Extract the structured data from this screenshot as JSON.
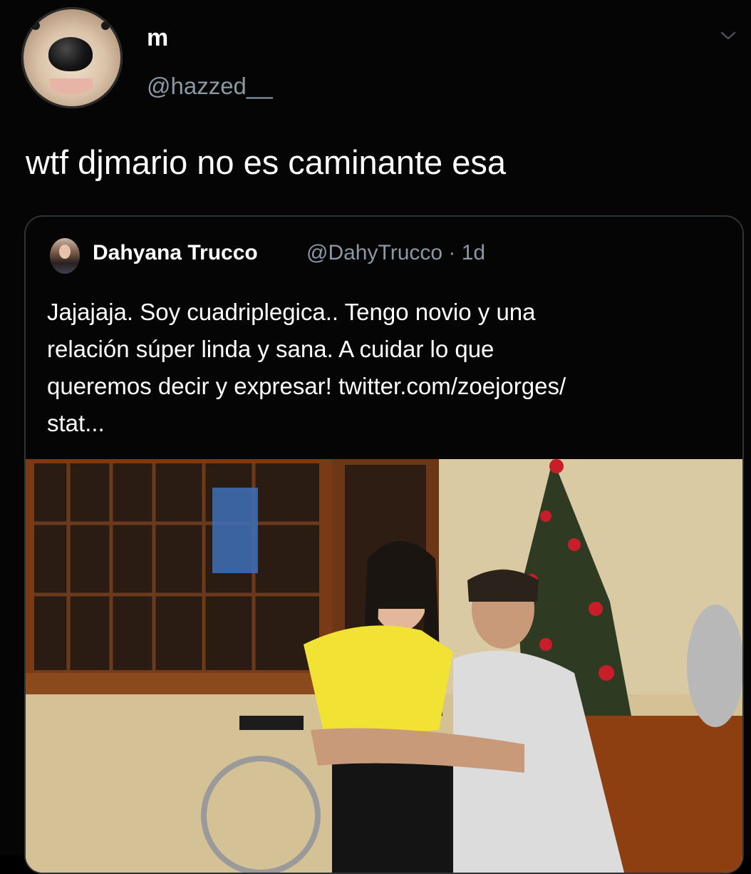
{
  "tweet": {
    "author": {
      "display_name": "m",
      "handle": "@hazzed__"
    },
    "text": "wtf djmario no es caminante esa",
    "menu_icon": "chevron-down-icon"
  },
  "quoted_tweet": {
    "author": {
      "display_name": "Dahyana Trucco",
      "handle": "@DahyTrucco",
      "separator": "·",
      "time": "1d"
    },
    "lines": [
      "Jajajaja. Soy cuadriplegica.. Tengo novio y una",
      "relación súper linda y sana. A cuidar lo que",
      "queremos decir y expresar! twitter.com/zoejorges/",
      "stat..."
    ]
  },
  "colors": {
    "background": "#050505",
    "text_primary": "#ffffff",
    "text_secondary": "#8b98a5",
    "border": "#2f3336"
  }
}
